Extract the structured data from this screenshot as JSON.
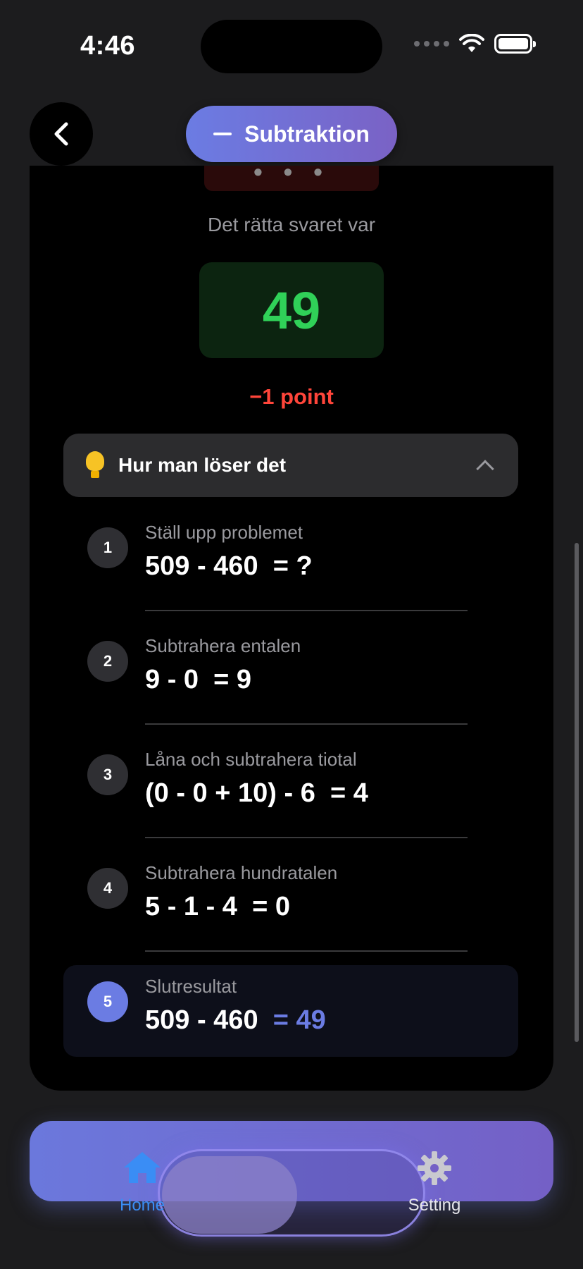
{
  "status_bar": {
    "time": "4:46"
  },
  "header": {
    "title": "Subtraktion"
  },
  "result": {
    "correct_label": "Det rätta svaret var",
    "correct_answer": "49",
    "penalty": "−1 point"
  },
  "howto": {
    "label": "Hur man löser det"
  },
  "steps": [
    {
      "num": "1",
      "title": "Ställ upp problemet",
      "expr": "509 - 460",
      "result": "= ?"
    },
    {
      "num": "2",
      "title": "Subtrahera entalen",
      "expr": "9 - 0",
      "result": "= 9"
    },
    {
      "num": "3",
      "title": "Låna och subtrahera tiotal",
      "expr": "(0 - 0 + 10) - 6",
      "result": "= 4"
    },
    {
      "num": "4",
      "title": "Subtrahera hundratalen",
      "expr": "5 - 1 - 4",
      "result": "= 0"
    },
    {
      "num": "5",
      "title": "Slutresultat",
      "expr": "509 - 460",
      "result": "= 49"
    }
  ],
  "tabbar": {
    "home": "Home",
    "setting": "Setting"
  },
  "colors": {
    "accent": "#6b7ce3",
    "correct": "#30d158",
    "penalty": "#ff453a",
    "tab_active": "#3a8df5"
  }
}
